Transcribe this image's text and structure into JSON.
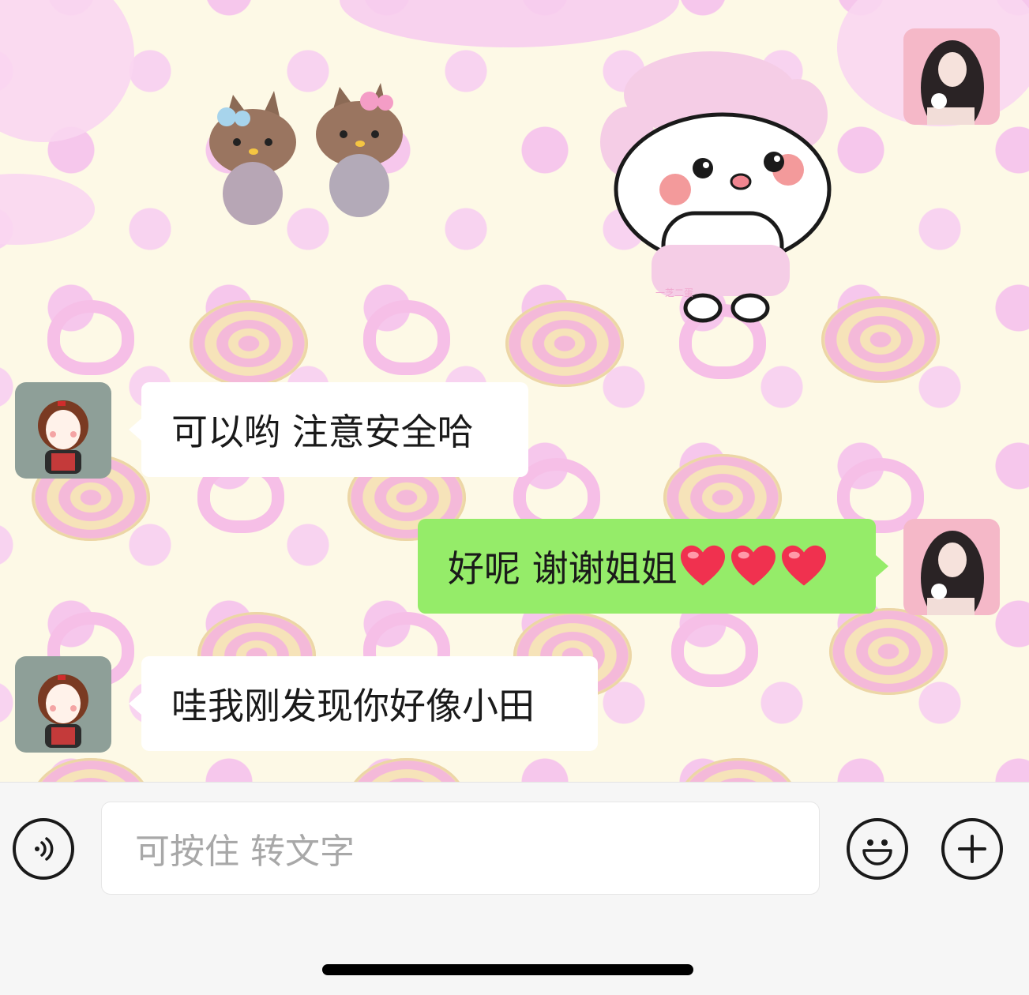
{
  "messages": [
    {
      "side": "received",
      "text": "可以哟 注意安全哈"
    },
    {
      "side": "sent",
      "text": "好呢 谢谢姐姐"
    },
    {
      "side": "received",
      "text": "哇我刚发现你好像小田"
    }
  ],
  "sticker": {
    "label": "一芝二蛋"
  },
  "input": {
    "placeholder": "可按住 转文字"
  },
  "colors": {
    "sent_bubble": "#95ec69",
    "received_bubble": "#ffffff",
    "wallpaper": "#fdf9e6"
  },
  "icons": [
    "voice-icon",
    "emoji-icon",
    "plus-icon",
    "heart-icon"
  ]
}
